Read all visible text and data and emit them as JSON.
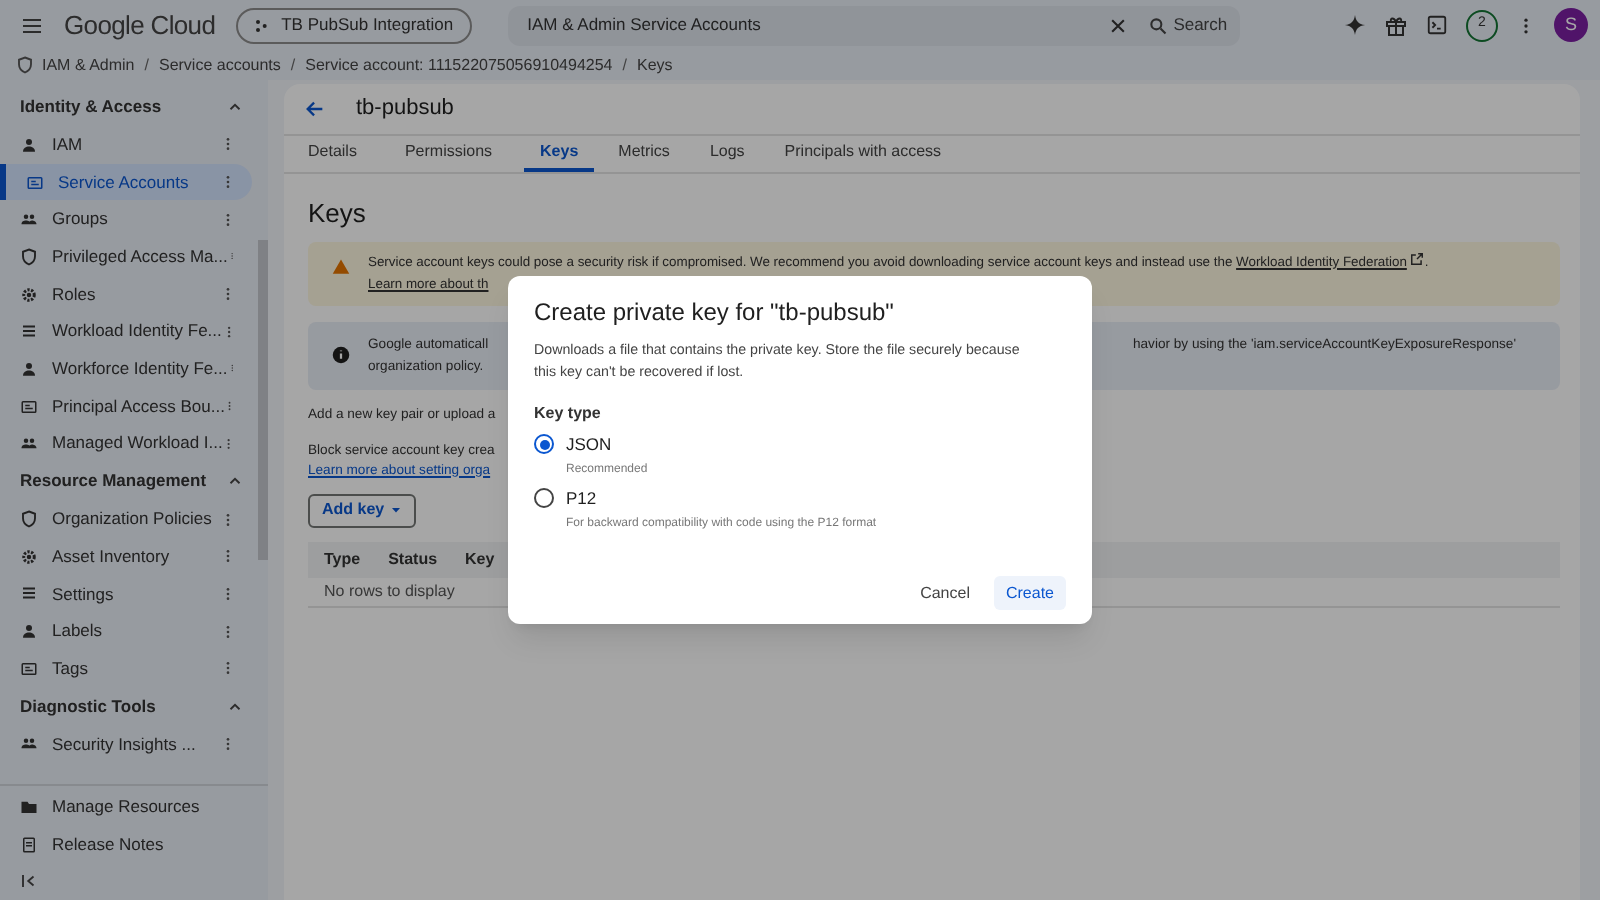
{
  "top_bar": {
    "logo": "Google Cloud",
    "project": "TB PubSub Integration",
    "search": {
      "value": "IAM & Admin Service Accounts",
      "button": "Search"
    },
    "notification_count": "2",
    "avatar": "S"
  },
  "breadcrumb": {
    "separator": "/",
    "items": [
      "IAM & Admin",
      "Service accounts",
      "Service account: 111522075056910494254",
      "Keys"
    ]
  },
  "sidebar": {
    "sections": [
      {
        "title": "Identity & Access",
        "expanded": true,
        "items": [
          {
            "label": "IAM",
            "selected": false
          },
          {
            "label": "Service Accounts",
            "selected": true
          },
          {
            "label": "Groups",
            "selected": false
          },
          {
            "label": "Privileged Access Ma...",
            "selected": false
          },
          {
            "label": "Roles",
            "selected": false
          },
          {
            "label": "Workload Identity Fe...",
            "selected": false
          },
          {
            "label": "Workforce Identity Fe...",
            "selected": false
          },
          {
            "label": "Principal Access Bou...",
            "selected": false
          },
          {
            "label": "Managed Workload I...",
            "selected": false
          }
        ]
      },
      {
        "title": "Resource Management",
        "expanded": true,
        "items": [
          {
            "label": "Organization Policies",
            "selected": false
          },
          {
            "label": "Asset Inventory",
            "selected": false
          },
          {
            "label": "Settings",
            "selected": false
          },
          {
            "label": "Labels",
            "selected": false
          },
          {
            "label": "Tags",
            "selected": false
          }
        ]
      },
      {
        "title": "Diagnostic Tools",
        "expanded": true,
        "items": [
          {
            "label": "Security Insights ...",
            "selected": false
          }
        ]
      }
    ],
    "footer": [
      "Manage Resources",
      "Release Notes"
    ]
  },
  "page": {
    "title": "tb-pubsub",
    "tabs": [
      {
        "label": "Details",
        "selected": false
      },
      {
        "label": "Permissions",
        "selected": false
      },
      {
        "label": "Keys",
        "selected": true
      },
      {
        "label": "Metrics",
        "selected": false
      },
      {
        "label": "Logs",
        "selected": false
      },
      {
        "label": "Principals with access",
        "selected": false
      }
    ],
    "heading": "Keys",
    "warning": {
      "text": "Service account keys could pose a security risk if compromised. We recommend you avoid downloading service account keys and instead use the ",
      "link": "Workload Identity Federation",
      "end": ".",
      "line_2": "Learn more about th"
    },
    "info": {
      "line_1_left": "Google automaticall",
      "line_1_right": "havior by using the 'iam.serviceAccountKeyExposureResponse'",
      "line_2": "organization policy."
    },
    "add_text": "Add a new key pair or upload a",
    "block_text": "Block service account key crea",
    "block_link": "Learn more about setting orga",
    "add_key_button": "Add key",
    "table": {
      "columns": [
        "Type",
        "Status",
        "Key"
      ],
      "empty": "No rows to display"
    }
  },
  "dialog": {
    "title": "Create private key for \"tb-pubsub\"",
    "description": "Downloads a file that contains the private key. Store the file securely because this key can't be recovered if lost.",
    "group_label": "Key type",
    "options": [
      {
        "label": "JSON",
        "description": "Recommended",
        "selected": true
      },
      {
        "label": "P12",
        "description": "For backward compatibility with code using the P12 format",
        "selected": false
      }
    ],
    "buttons": [
      {
        "label": "Cancel",
        "primary": false
      },
      {
        "label": "Create",
        "primary": true
      }
    ]
  }
}
